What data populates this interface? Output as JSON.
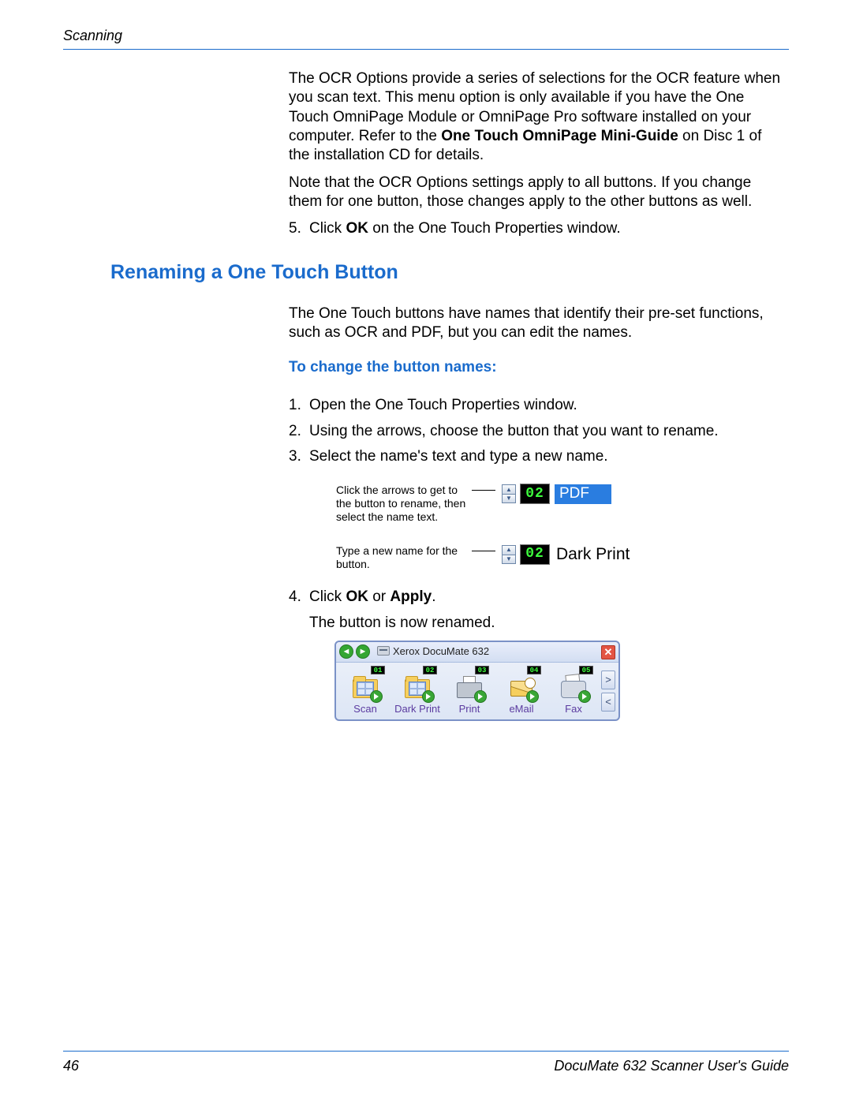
{
  "header": {
    "section": "Scanning"
  },
  "footer": {
    "page": "46",
    "guide": "DocuMate 632 Scanner User's Guide"
  },
  "intro": {
    "p1_a": "The OCR Options provide a series of selections for the OCR feature when you scan text. This menu option is only available if you have the One Touch OmniPage Module or OmniPage Pro software installed on your computer. Refer to the ",
    "p1_b": "One Touch OmniPage Mini-Guide",
    "p1_c": " on Disc 1 of the installation CD for details.",
    "p2": "Note that the OCR Options settings apply to all buttons. If you change them for one button, those changes apply to the other buttons as well."
  },
  "steps_top": {
    "5_num": "5.",
    "5_a": "Click ",
    "5_b": "OK",
    "5_c": " on the One Touch Properties window."
  },
  "section": {
    "title": "Renaming a One Touch Button",
    "intro": "The One Touch buttons have names that identify their pre-set functions, such as OCR and PDF, but you can edit the names.",
    "subheading": "To change the button names:"
  },
  "steps": {
    "1_num": "1.",
    "1": "Open the One Touch Properties window.",
    "2_num": "2.",
    "2": "Using the arrows, choose the button that you want to rename.",
    "3_num": "3.",
    "3": "Select the name's text and type a new name.",
    "4_num": "4.",
    "4_a": "Click ",
    "4_b": "OK",
    "4_c": " or ",
    "4_d": "Apply",
    "4_e": ".",
    "result": "The button is now renamed."
  },
  "callout": {
    "c1": "Click the arrows to get to the button to rename, then select the name text.",
    "c2": "Type a new name for the button.",
    "lcd": "02",
    "label_pdf": "PDF",
    "label_dark": "Dark Print"
  },
  "toolbar": {
    "title": "Xerox DocuMate 632",
    "close": "✕",
    "items": [
      {
        "num": "01",
        "label": "Scan",
        "icon": "docgrid"
      },
      {
        "num": "02",
        "label": "Dark Print",
        "icon": "docgrid"
      },
      {
        "num": "03",
        "label": "Print",
        "icon": "printer"
      },
      {
        "num": "04",
        "label": "eMail",
        "icon": "mail"
      },
      {
        "num": "05",
        "label": "Fax",
        "icon": "fax"
      }
    ],
    "side_next": ">",
    "side_prev": "<"
  }
}
